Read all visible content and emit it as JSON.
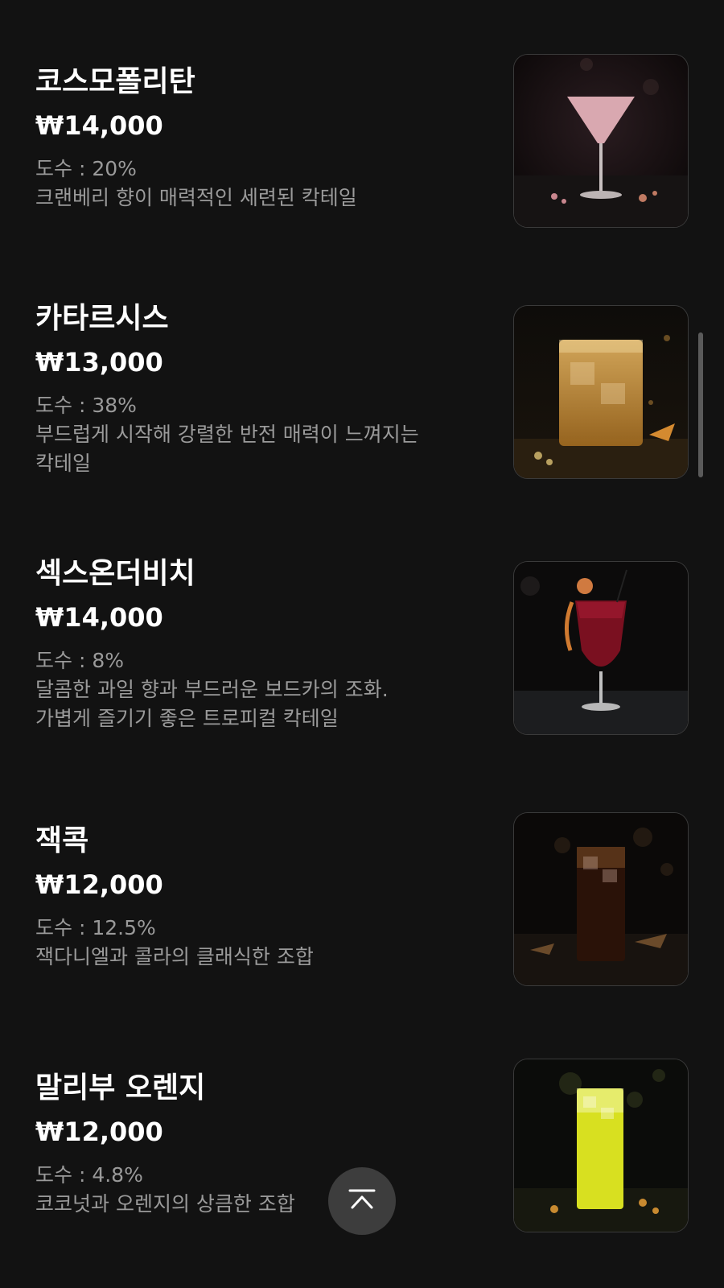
{
  "menu": {
    "items": [
      {
        "name": "코스모폴리탄",
        "price": "₩14,000",
        "abv": "도수 : 20%",
        "description": [
          "크랜베리 향이 매력적인 세련된 칵테일"
        ]
      },
      {
        "name": "카타르시스",
        "price": "₩13,000",
        "abv": "도수 : 38%",
        "description": [
          "부드럽게 시작해 강렬한 반전 매력이 느껴지는",
          "칵테일"
        ]
      },
      {
        "name": "섹스온더비치",
        "price": "₩14,000",
        "abv": "도수 : 8%",
        "description": [
          "달콤한 과일 향과 부드러운 보드카의 조화.",
          "가볍게 즐기기 좋은 트로피컬 칵테일"
        ]
      },
      {
        "name": "잭콕",
        "price": "₩12,000",
        "abv": "도수 : 12.5%",
        "description": [
          "잭다니엘과 콜라의 클래식한 조합"
        ]
      },
      {
        "name": "말리부 오렌지",
        "price": "₩12,000",
        "abv": "도수 : 4.8%",
        "description": [
          "코코넛과 오렌지의 상큼한 조합"
        ]
      }
    ]
  },
  "icons": {
    "top_button": "chevron-up-icon"
  },
  "colors": {
    "background": "#121212",
    "text_primary": "#ffffff",
    "text_secondary": "#9a9a9a",
    "button_bg": "#3d3d3d"
  }
}
